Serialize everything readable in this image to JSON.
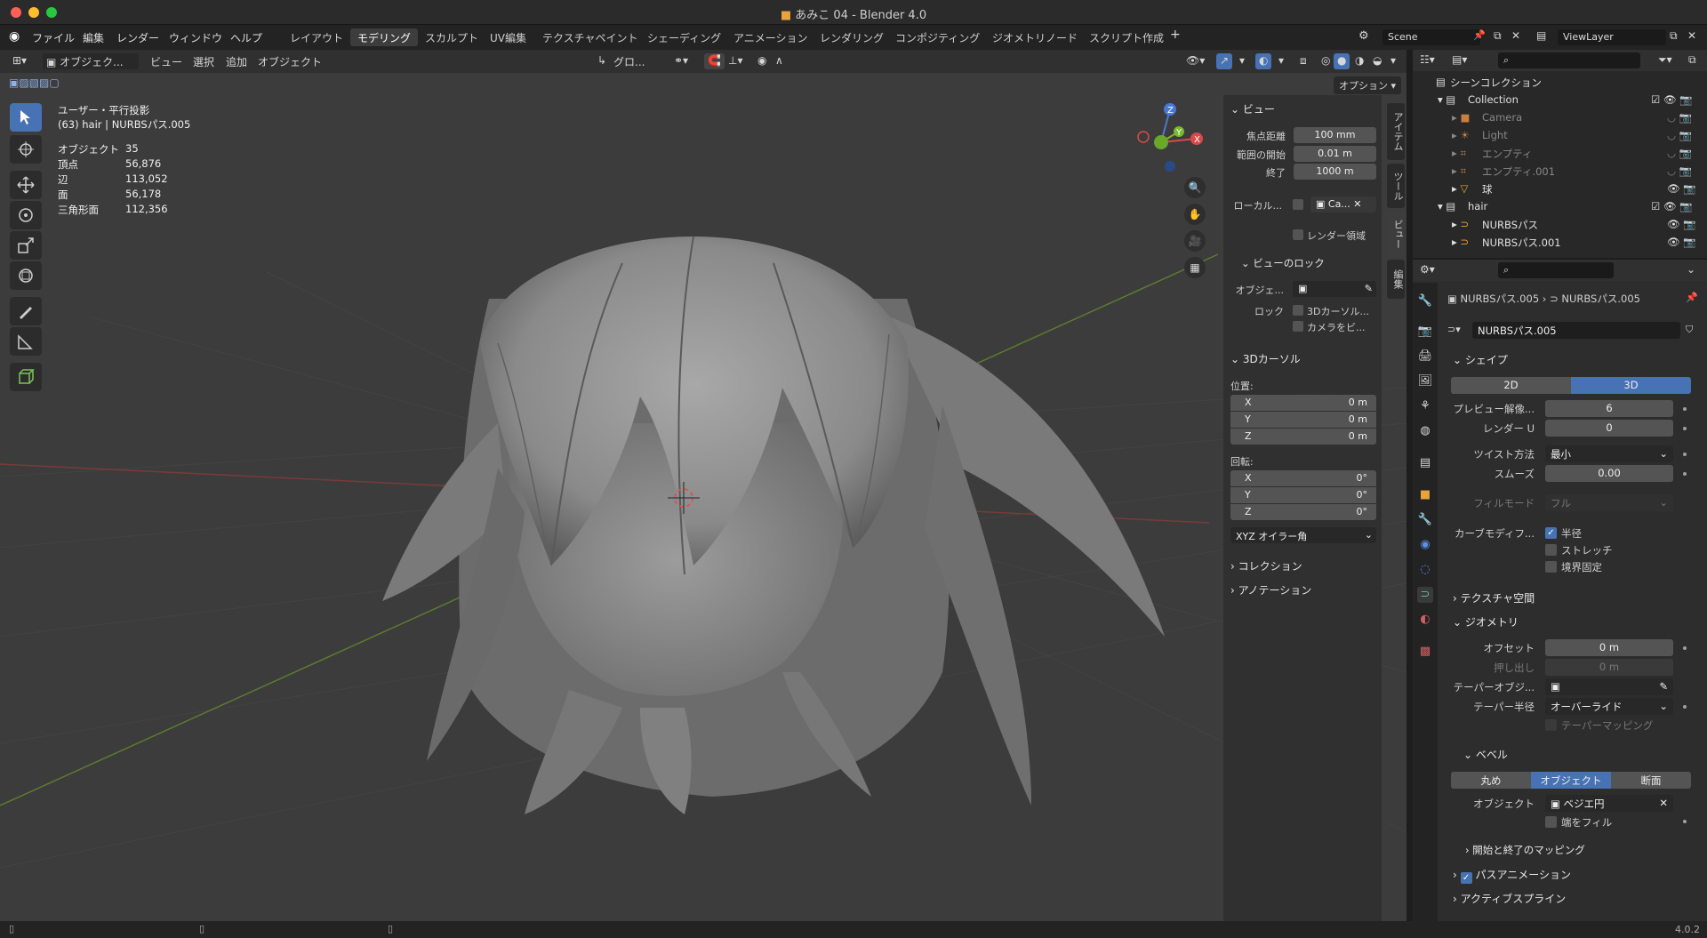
{
  "window": {
    "title": "あみこ 04 - Blender 4.0",
    "version": "4.0.2"
  },
  "menu": [
    "ファイル",
    "編集",
    "レンダー",
    "ウィンドウ",
    "ヘルプ"
  ],
  "workspaces": [
    "レイアウト",
    "モデリング",
    "スカルプト",
    "UV編集",
    "テクスチャペイント",
    "シェーディング",
    "アニメーション",
    "レンダリング",
    "コンポジティング",
    "ジオメトリノード",
    "スクリプト作成"
  ],
  "active_workspace": "モデリング",
  "scene": {
    "scene_name": "Scene",
    "view_layer": "ViewLayer"
  },
  "viewport": {
    "mode": "オブジェク...",
    "menus": [
      "ビュー",
      "選択",
      "追加",
      "オブジェクト"
    ],
    "transform_orientation": "グロ...",
    "options_label": "オプション",
    "view_name": "ユーザー・平行投影",
    "active_info": "(63) hair | NURBSパス.005",
    "stats": [
      {
        "label": "オブジェクト",
        "value": "35"
      },
      {
        "label": "頂点",
        "value": "56,876"
      },
      {
        "label": "辺",
        "value": "113,052"
      },
      {
        "label": "面",
        "value": "56,178"
      },
      {
        "label": "三角形面",
        "value": "112,356"
      }
    ],
    "gizmo": {
      "x": "X",
      "y": "Y",
      "z": "Z"
    }
  },
  "npanel": {
    "tabs": [
      "アイテム",
      "ツール",
      "ビュー",
      "編集"
    ],
    "view_header": "ビュー",
    "focal_label": "焦点距離",
    "focal_value": "100 mm",
    "clip_start_label": "範囲の開始",
    "clip_start_value": "0.01 m",
    "clip_end_label": "終了",
    "clip_end_value": "1000 m",
    "local_camera_label": "ローカル...",
    "local_camera_value": "Ca...",
    "render_region": "レンダー領域",
    "view_lock_header": "ビューのロック",
    "lock_object_label": "オブジェ...",
    "lock_label": "ロック",
    "lock_cursor": "3Dカーソル...",
    "lock_camera": "カメラをビ...",
    "cursor_header": "3Dカーソル",
    "location_label": "位置:",
    "location": [
      {
        "axis": "X",
        "value": "0 m"
      },
      {
        "axis": "Y",
        "value": "0 m"
      },
      {
        "axis": "Z",
        "value": "0 m"
      }
    ],
    "rotation_label": "回転:",
    "rotation": [
      {
        "axis": "X",
        "value": "0°"
      },
      {
        "axis": "Y",
        "value": "0°"
      },
      {
        "axis": "Z",
        "value": "0°"
      }
    ],
    "rotation_mode": "XYZ オイラー角",
    "collection_header": "コレクション",
    "annotation_header": "アノテーション"
  },
  "outliner": {
    "root": "シーンコレクション",
    "rows": [
      {
        "name": "Collection",
        "indent": 1
      },
      {
        "name": "Camera",
        "indent": 2
      },
      {
        "name": "Light",
        "indent": 2
      },
      {
        "name": "エンプティ",
        "indent": 2
      },
      {
        "name": "エンプティ.001",
        "indent": 2
      },
      {
        "name": "球",
        "indent": 2
      },
      {
        "name": "hair",
        "indent": 1
      },
      {
        "name": "NURBSパス",
        "indent": 2
      },
      {
        "name": "NURBSパス.001",
        "indent": 2
      }
    ]
  },
  "properties": {
    "breadcrumb_object": "NURBSパス.005",
    "breadcrumb_data": "NURBSパス.005",
    "datablock_name": "NURBSパス.005",
    "shape_header": "シェイプ",
    "dim_2d": "2D",
    "dim_3d": "3D",
    "preview_res_label": "プレビュー解像...",
    "preview_res_value": "6",
    "render_u_label": "レンダー U",
    "render_u_value": "0",
    "twist_label": "ツイスト方法",
    "twist_value": "最小",
    "smooth_label": "スムーズ",
    "smooth_value": "0.00",
    "fill_mode_label": "フィルモード",
    "fill_mode_value": "フル",
    "curve_deform_label": "カーブモディフ...",
    "radius_label": "半径",
    "stretch_label": "ストレッチ",
    "bounds_label": "境界固定",
    "texture_space_header": "テクスチャ空間",
    "geometry_header": "ジオメトリ",
    "offset_label": "オフセット",
    "offset_value": "0 m",
    "extrude_label": "押し出し",
    "extrude_value": "0 m",
    "taper_obj_label": "テーパーオブジ...",
    "taper_radius_label": "テーパー半径",
    "taper_radius_value": "オーバーライド",
    "taper_mapping_label": "テーパーマッピング",
    "bevel_header": "ベベル",
    "bevel_round": "丸め",
    "bevel_object": "オブジェクト",
    "bevel_profile": "断面",
    "bevel_obj_label": "オブジェクト",
    "bevel_obj_value": "ベジエ円",
    "fill_caps_label": "端をフィル",
    "start_end_header": "開始と終了のマッピング",
    "path_anim_header": "パスアニメーション",
    "active_spline_header": "アクティブスプライン"
  },
  "colors": {
    "accent": "#4772b3",
    "viewport_bg": "#3c3c3c",
    "panel_bg": "#2d2d2d"
  }
}
